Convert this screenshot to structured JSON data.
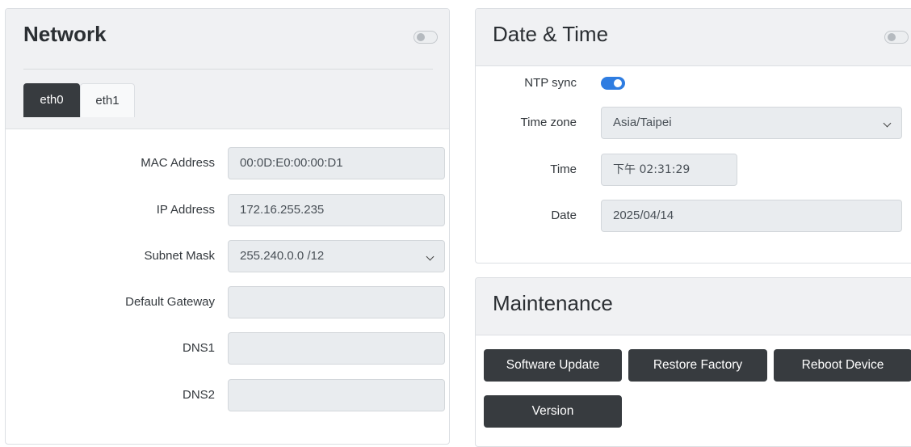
{
  "network": {
    "title": "Network",
    "toggle_on": false,
    "tabs": [
      {
        "label": "eth0",
        "active": true
      },
      {
        "label": "eth1",
        "active": false
      }
    ],
    "fields": [
      {
        "label": "MAC Address",
        "value": "00:0D:E0:00:00:D1",
        "type": "text"
      },
      {
        "label": "IP Address",
        "value": "172.16.255.235",
        "type": "text"
      },
      {
        "label": "Subnet Mask",
        "value": "255.240.0.0 /12",
        "type": "select"
      },
      {
        "label": "Default Gateway",
        "value": "",
        "type": "text"
      },
      {
        "label": "DNS1",
        "value": "",
        "type": "text"
      },
      {
        "label": "DNS2",
        "value": "",
        "type": "text"
      }
    ]
  },
  "datetime": {
    "title": "Date & Time",
    "toggle_on": false,
    "ntp": {
      "label": "NTP sync",
      "on": true
    },
    "timezone": {
      "label": "Time zone",
      "value": "Asia/Taipei"
    },
    "time": {
      "label": "Time",
      "value": "下午 02:31:29"
    },
    "date": {
      "label": "Date",
      "value": "2025/04/14"
    }
  },
  "maintenance": {
    "title": "Maintenance",
    "buttons": {
      "software_update": "Software Update",
      "restore_factory": "Restore Factory",
      "reboot_device": "Reboot Device",
      "version": "Version"
    }
  },
  "colors": {
    "toggle_on": "#2f7de1",
    "button_dark": "#373b3f",
    "header_bg": "#f0f1f3",
    "field_bg": "#e9ecef"
  }
}
